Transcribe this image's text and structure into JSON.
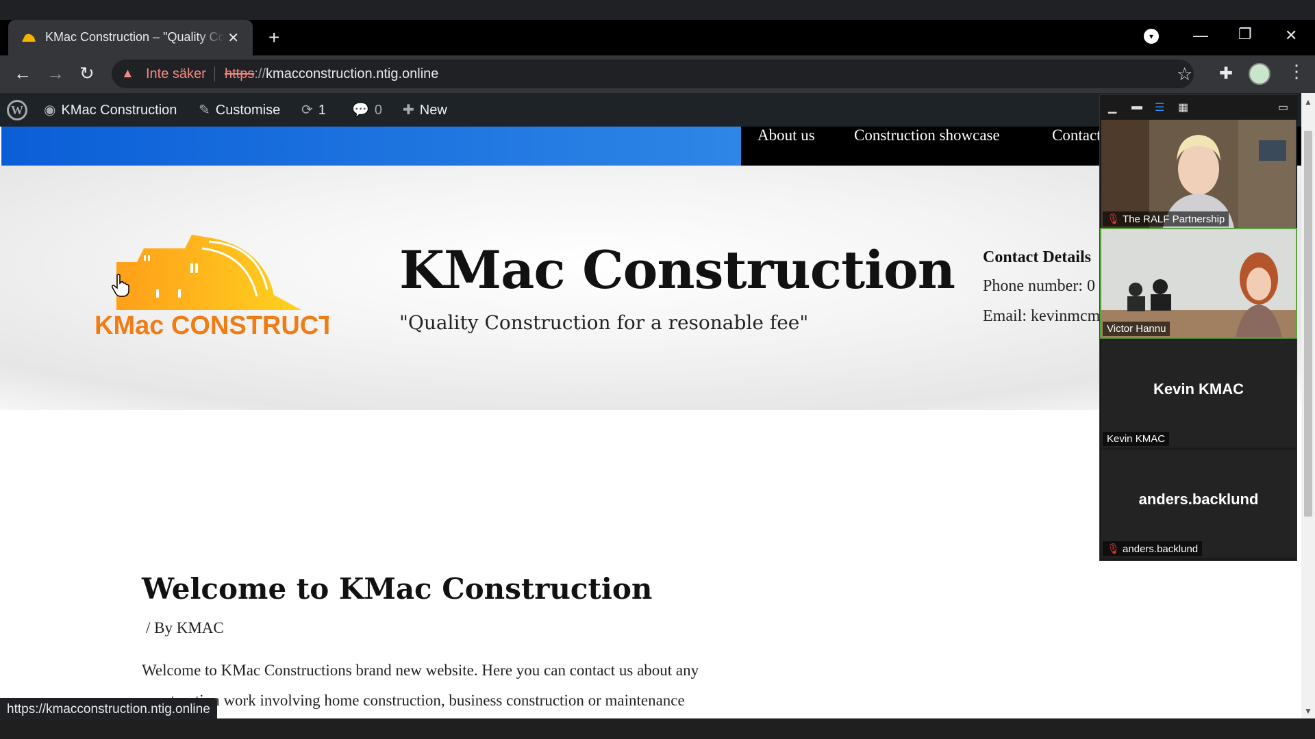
{
  "browser": {
    "tab_title": "KMac Construction – \"Quality Construction for a resonable fee\"",
    "tab_close": "✕",
    "new_tab": "+",
    "insecure_label": "Inte säker",
    "url_scheme": "https",
    "url_sep": "://",
    "url_host": "kmacconstruction.ntig.online",
    "status_url": "https://kmacconstruction.ntig.online"
  },
  "wp_admin_bar": {
    "site_name": "KMac Construction",
    "customise": "Customise",
    "updates_count": "1",
    "comments_count": "0",
    "new": "New"
  },
  "site": {
    "nav": [
      "About us",
      "Construction showcase",
      "Contact"
    ],
    "logo_text": "KMac CONSTRUCTION",
    "title": "KMac Construction",
    "tagline": "\"Quality Construction for a resonable fee\"",
    "contact_heading": "Contact Details",
    "phone_line": "Phone number: 0",
    "email_line": "Email: kevinmcm"
  },
  "post": {
    "title": "Welcome to KMac Construction",
    "byline": "/ By KMAC",
    "para_line1": "Welcome to KMac Constructions brand new website. Here you can contact us about any",
    "para_line2": "construction work involving home construction, business construction or maintenance"
  },
  "meeting": {
    "participants": [
      {
        "name": "The RALF Partnership",
        "muted": true,
        "video": true
      },
      {
        "name": "Victor Hannu",
        "muted": false,
        "video": true
      },
      {
        "name": "Kevin KMAC",
        "muted": false,
        "video": false
      },
      {
        "name": "anders.backlund",
        "muted": true,
        "video": false
      }
    ]
  },
  "colors": {
    "accent_blue": "#0b5ed7",
    "logo_orange": "#f39c12",
    "logo_yellow": "#ffd01f",
    "insecure_red": "#f28b82",
    "speaker_green": "#5aa342"
  }
}
